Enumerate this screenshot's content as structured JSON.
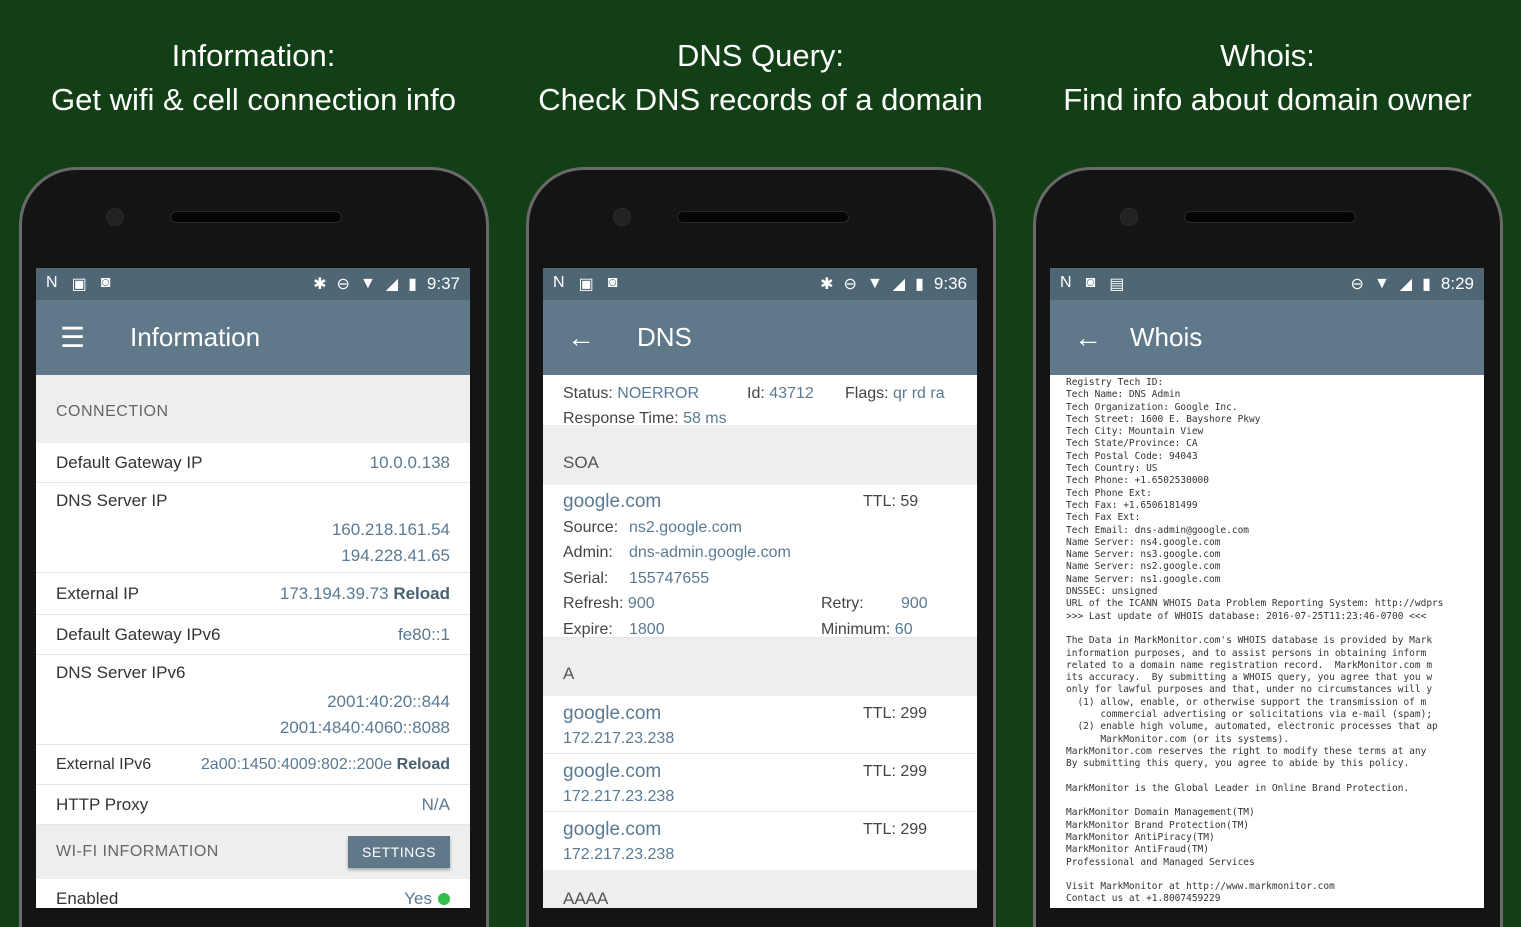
{
  "captions": [
    {
      "line1": "Information:",
      "line2": "Get wifi & cell connection info"
    },
    {
      "line1": "DNS Query:",
      "line2": "Check DNS records of a domain"
    },
    {
      "line1": "Whois:",
      "line2": "Find info about domain owner"
    }
  ],
  "phones": [
    {
      "time": "9:37",
      "title": "Information",
      "nav_icon": "hamburger-icon"
    },
    {
      "time": "9:36",
      "title": "DNS",
      "nav_icon": "back-arrow-icon"
    },
    {
      "time": "8:29",
      "title": "Whois",
      "nav_icon": "back-arrow-icon"
    }
  ],
  "info": {
    "connection_header": "CONNECTION",
    "default_gateway_label": "Default Gateway IP",
    "default_gateway_value": "10.0.0.138",
    "dns_server_label": "DNS Server IP",
    "dns_server_value1": "160.218.161.54",
    "dns_server_value2": "194.228.41.65",
    "external_ip_label": "External IP",
    "external_ip_value": "173.194.39.73",
    "reload": "Reload",
    "gateway_ipv6_label": "Default Gateway IPv6",
    "gateway_ipv6_value": "fe80::1",
    "dns_ipv6_label": "DNS Server IPv6",
    "dns_ipv6_value1": "2001:40:20::844",
    "dns_ipv6_value2": "2001:4840:4060::8088",
    "external_ipv6_label": "External IPv6",
    "external_ipv6_value": "2a00:1450:4009:802::200e",
    "http_proxy_label": "HTTP Proxy",
    "http_proxy_value": "N/A",
    "wifi_header": "WI-FI INFORMATION",
    "settings_button": "SETTINGS",
    "enabled_label": "Enabled",
    "enabled_value": "Yes"
  },
  "dns": {
    "status_label": "Status:",
    "status_value": "NOERROR",
    "id_label": "Id:",
    "id_value": "43712",
    "flags_label": "Flags:",
    "flags_value": "qr rd ra",
    "response_label": "Response Time:",
    "response_value": "58 ms",
    "soa_header": "SOA",
    "soa_domain": "google.com",
    "soa_ttl": "TTL: 59",
    "source_label": "Source:",
    "source_value": "ns2.google.com",
    "admin_label": "Admin:",
    "admin_value": "dns-admin.google.com",
    "serial_label": "Serial:",
    "serial_value": "155747655",
    "refresh_label": "Refresh:",
    "refresh_value": "900",
    "retry_label": "Retry:",
    "retry_value": "900",
    "expire_label": "Expire:",
    "expire_value": "1800",
    "minimum_label": "Minimum:",
    "minimum_value": "60",
    "a_header": "A",
    "a_records": [
      {
        "domain": "google.com",
        "ttl": "TTL: 299",
        "ip": "172.217.23.238"
      },
      {
        "domain": "google.com",
        "ttl": "TTL: 299",
        "ip": "172.217.23.238"
      },
      {
        "domain": "google.com",
        "ttl": "TTL: 299",
        "ip": "172.217.23.238"
      }
    ],
    "aaaa_header": "AAAA"
  },
  "whois": {
    "lines": [
      "Registry Tech ID:",
      "Tech Name: DNS Admin",
      "Tech Organization: Google Inc.",
      "Tech Street: 1600 E. Bayshore Pkwy",
      "Tech City: Mountain View",
      "Tech State/Province: CA",
      "Tech Postal Code: 94043",
      "Tech Country: US",
      "Tech Phone: +1.6502530000",
      "Tech Phone Ext:",
      "Tech Fax: +1.6506181499",
      "Tech Fax Ext:",
      "Tech Email: dns-admin@google.com",
      "Name Server: ns4.google.com",
      "Name Server: ns3.google.com",
      "Name Server: ns2.google.com",
      "Name Server: ns1.google.com",
      "DNSSEC: unsigned",
      "URL of the ICANN WHOIS Data Problem Reporting System: http://wdprs",
      ">>> Last update of WHOIS database: 2016-07-25T11:23:46-0700 <<<",
      "",
      "The Data in MarkMonitor.com's WHOIS database is provided by Mark",
      "information purposes, and to assist persons in obtaining inform",
      "related to a domain name registration record.  MarkMonitor.com m",
      "its accuracy.  By submitting a WHOIS query, you agree that you w",
      "only for lawful purposes and that, under no circumstances will y",
      "  (1) allow, enable, or otherwise support the transmission of m",
      "      commercial advertising or solicitations via e-mail (spam);",
      "  (2) enable high volume, automated, electronic processes that ap",
      "      MarkMonitor.com (or its systems).",
      "MarkMonitor.com reserves the right to modify these terms at any",
      "By submitting this query, you agree to abide by this policy.",
      "",
      "MarkMonitor is the Global Leader in Online Brand Protection.",
      "",
      "MarkMonitor Domain Management(TM)",
      "MarkMonitor Brand Protection(TM)",
      "MarkMonitor AntiPiracy(TM)",
      "MarkMonitor AntiFraud(TM)",
      "Professional and Managed Services",
      "",
      "Visit MarkMonitor at http://www.markmonitor.com",
      "Contact us at +1.8007459229"
    ]
  }
}
